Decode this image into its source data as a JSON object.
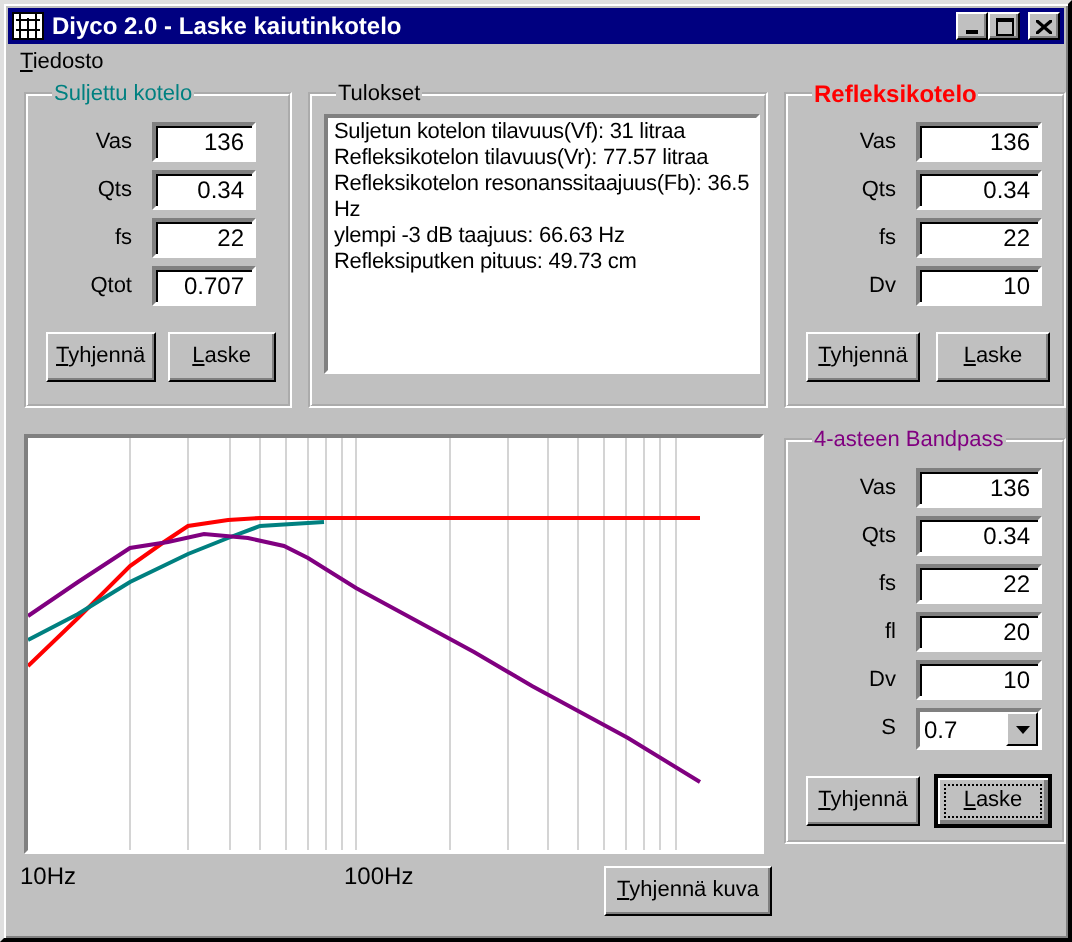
{
  "window": {
    "title": "Diyco 2.0 - Laske kaiutinkotelo"
  },
  "menu": [
    {
      "label": "Tiedosto"
    }
  ],
  "closed_box": {
    "title": "Suljettu kotelo",
    "color": "#008080",
    "bold": false,
    "fields": [
      {
        "kind": "text",
        "label": "Vas",
        "value": "136"
      },
      {
        "kind": "text",
        "label": "Qts",
        "value": "0.34"
      },
      {
        "kind": "text",
        "label": "fs",
        "value": "22"
      },
      {
        "kind": "text",
        "label": "Qtot",
        "value": "0.707"
      }
    ],
    "buttons": [
      {
        "label": "Tyhjennä",
        "focused": false
      },
      {
        "label": "Laske",
        "focused": false
      }
    ]
  },
  "results": {
    "title": "Tulokset",
    "lines": [
      "Suljetun kotelon tilavuus(Vf): 31 litraa",
      "Refleksikotelon tilavuus(Vr): 77.57 litraa",
      "Refleksikotelon resonanssitaajuus(Fb): 36.5 Hz",
      "ylempi -3 dB taajuus: 66.63 Hz",
      "Refleksiputken pituus: 49.73 cm"
    ]
  },
  "reflex_box": {
    "title": "Refleksikotelo",
    "color": "#ff0000",
    "bold": true,
    "fields": [
      {
        "kind": "text",
        "label": "Vas",
        "value": "136"
      },
      {
        "kind": "text",
        "label": "Qts",
        "value": "0.34"
      },
      {
        "kind": "text",
        "label": "fs",
        "value": "22"
      },
      {
        "kind": "text",
        "label": "Dv",
        "value": "10"
      }
    ],
    "buttons": [
      {
        "label": "Tyhjennä",
        "focused": false
      },
      {
        "label": "Laske",
        "focused": false
      }
    ]
  },
  "chart": {
    "curves": [
      {
        "color": "#ff0000"
      },
      {
        "color": "#008080"
      },
      {
        "color": "#800080"
      }
    ],
    "axis_labels": [
      "10Hz",
      "100Hz"
    ],
    "button": {
      "label": "Tyhjennä kuva",
      "focused": false
    }
  },
  "bandpass_box": {
    "title": "4-asteen Bandpass",
    "color": "#800080",
    "bold": false,
    "fields": [
      {
        "kind": "text",
        "label": "Vas",
        "value": "136"
      },
      {
        "kind": "text",
        "label": "Qts",
        "value": "0.34"
      },
      {
        "kind": "text",
        "label": "fs",
        "value": "22"
      },
      {
        "kind": "text",
        "label": "fl",
        "value": "20"
      },
      {
        "kind": "text",
        "label": "Dv",
        "value": "10"
      },
      {
        "kind": "dropdown",
        "label": "S",
        "value": "0.7"
      }
    ],
    "buttons": [
      {
        "label": "Tyhjennä",
        "focused": false
      },
      {
        "label": "Laske",
        "focused": true
      }
    ]
  }
}
